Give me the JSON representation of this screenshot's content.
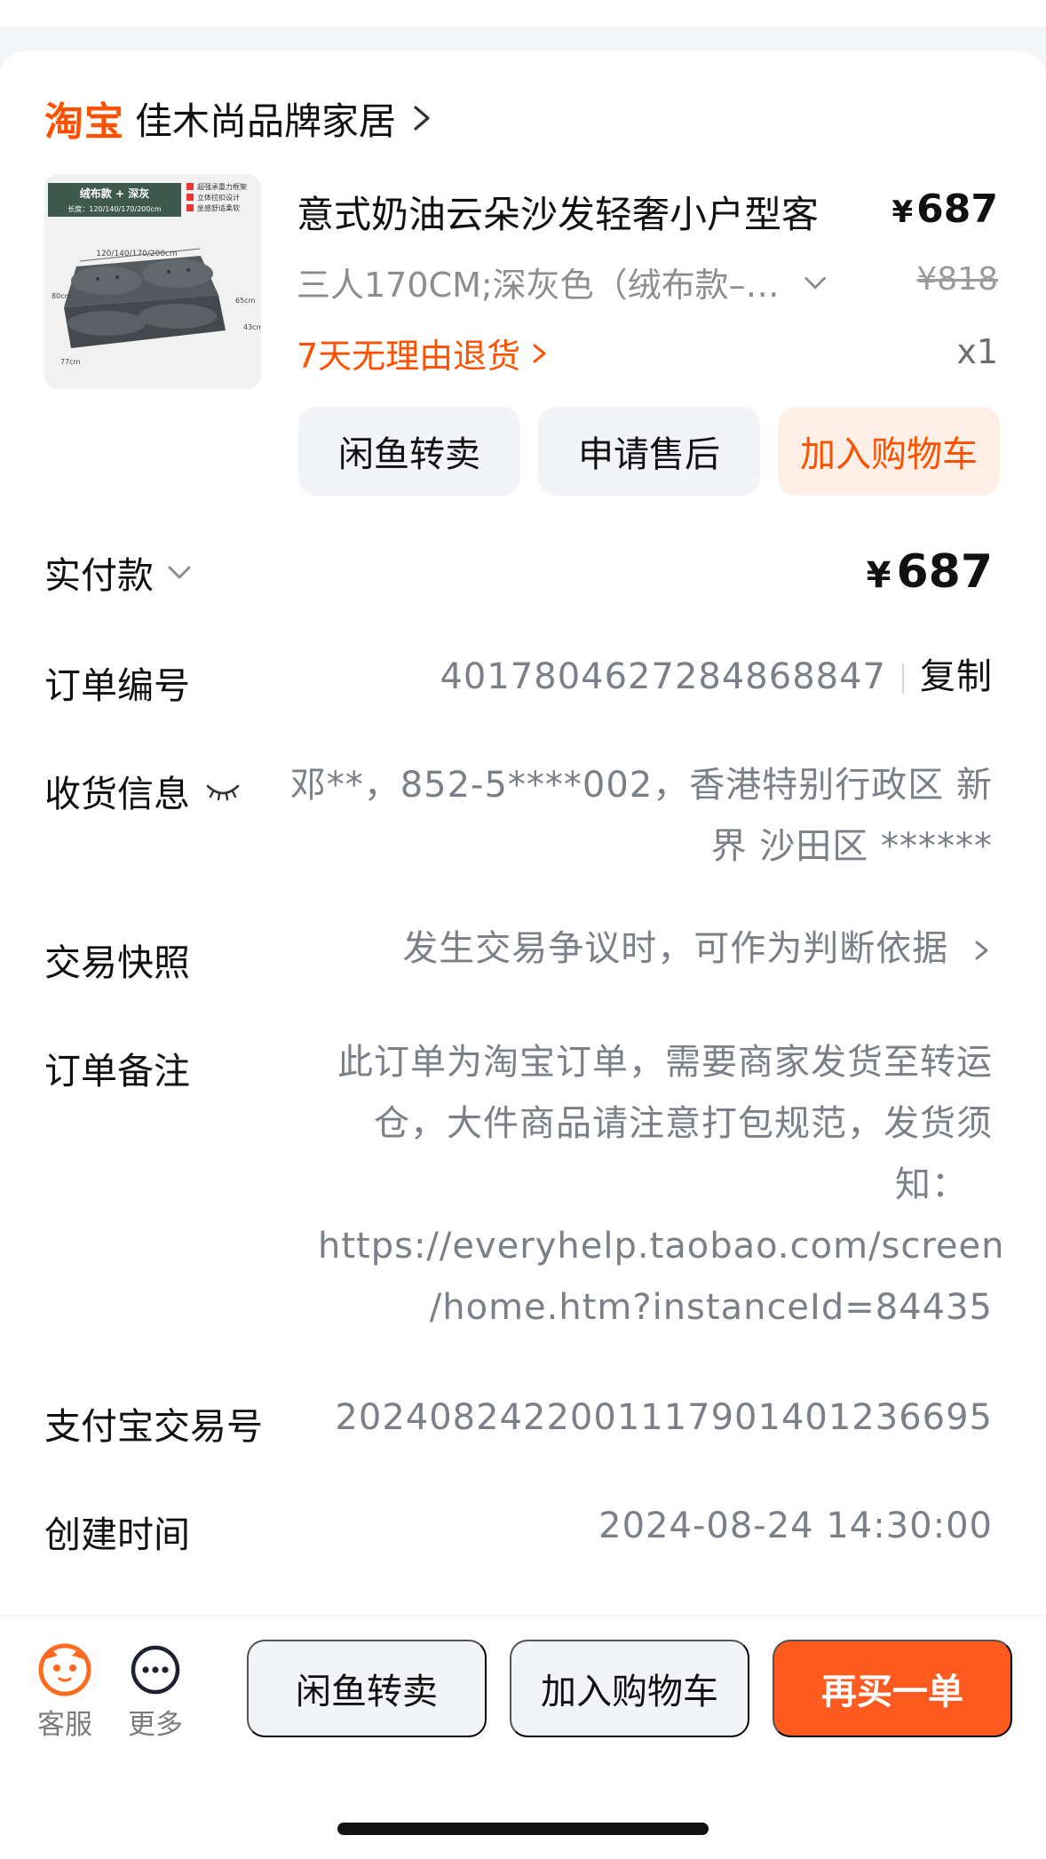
{
  "shop": {
    "logo_text": "淘宝",
    "name": "佳木尚品牌家居"
  },
  "product": {
    "title": "意式奶油云朵沙发轻奢小户型客",
    "price_symbol": "¥",
    "price": "687",
    "sku": "三人170CM;深灰色（绒布款–亲...",
    "original_price": "¥818",
    "return_policy": "7天无理由退货",
    "quantity": "x1",
    "thumbnail": {
      "banner_text": "绒布款 + 深灰",
      "size_text": "长度：120/140/170/200cm",
      "features": [
        "超强承重力框架",
        "立体拉扣设计",
        "坐感舒适柔软"
      ],
      "dimension_label": "120/140/170/200cm",
      "depth_label": "65cm",
      "side_label": "43cm",
      "height_label": "80cm",
      "bottom_label": "77cm"
    },
    "actions": [
      {
        "label": "闲鱼转卖"
      },
      {
        "label": "申请售后"
      },
      {
        "label": "加入购物车"
      }
    ]
  },
  "details": {
    "paid": {
      "label": "实付款",
      "symbol": "¥",
      "amount": "687"
    },
    "order_no": {
      "label": "订单编号",
      "value": "4017804627284868847",
      "copy_label": "复制"
    },
    "shipping": {
      "label": "收货信息",
      "value_line1": "邓**，852-5****002，香港特别行政区 新",
      "value_line2": "界 沙田区 ******"
    },
    "snapshot": {
      "label": "交易快照",
      "value": "发生交易争议时，可作为判断依据"
    },
    "remark": {
      "label": "订单备注",
      "lines": [
        "此订单为淘宝订单，需要商家发货至转运",
        "仓，大件商品请注意打包规范，发货须",
        "知：",
        "https://everyhelp.taobao.com/screen",
        "/home.htm?instanceId=84435"
      ]
    },
    "alipay": {
      "label": "支付宝交易号",
      "value": "2024082422001117901401236695"
    },
    "created": {
      "label": "创建时间",
      "value": "2024-08-24 14:30:00"
    }
  },
  "bottom_bar": {
    "service_label": "客服",
    "more_label": "更多",
    "resell_label": "闲鱼转卖",
    "cart_label": "加入购物车",
    "rebuy_label": "再买一单"
  },
  "colors": {
    "accent": "#ff5000",
    "primary_button": "#ff5a1f",
    "muted_text": "#7b7f87"
  }
}
